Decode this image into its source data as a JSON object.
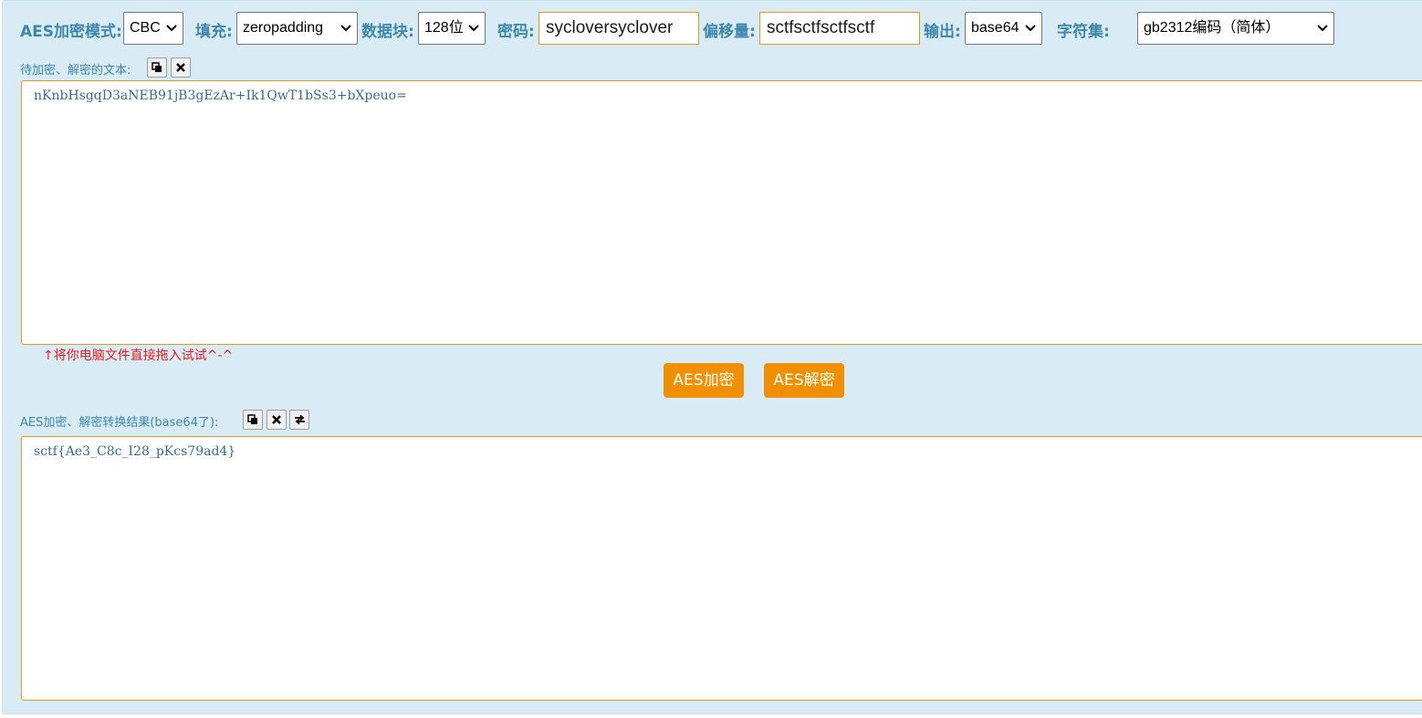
{
  "toolbar": {
    "mode_label": "AES加密模式:",
    "mode_value": "CBC",
    "padding_label": "填充:",
    "padding_value": "zeropadding",
    "block_label": "数据块:",
    "block_value": "128位",
    "key_label": "密码:",
    "key_value": "sycloversyclover",
    "iv_label": "偏移量:",
    "iv_value": "sctfsctfsctfsctf",
    "output_label": "输出:",
    "output_value": "base64",
    "charset_label": "字符集:",
    "charset_value": "gb2312编码（简体）"
  },
  "input": {
    "label": "待加密、解密的文本:",
    "text": "nKnbHsgqD3aNEB91jB3gEzAr+Ik1QwT1bSs3+bXpeuo=",
    "tip": "↑将你电脑文件直接拖入试试^-^"
  },
  "actions": {
    "encrypt_label": "AES加密",
    "decrypt_label": "AES解密"
  },
  "output": {
    "label": "AES加密、解密转换结果(base64了):",
    "text": "sctf{Ae3_C8c_I28_pKcs79ad4}"
  },
  "icons": {
    "copy": "copy-icon",
    "clear": "close-icon",
    "swap": "swap-icon"
  },
  "colors": {
    "panel_bg": "#d9ecf5",
    "label": "#3f86ab",
    "accent_orange": "#f09000",
    "border_orange": "#e8961e",
    "tip_red": "#e61e1e"
  }
}
